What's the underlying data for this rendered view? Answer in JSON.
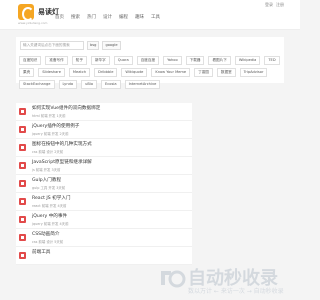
{
  "header": {
    "logo_text": "易读灯",
    "logo_sub": "www.yidudeng.com",
    "nav": [
      "首页",
      "搜索",
      "热门",
      "设计",
      "编程",
      "趣味",
      "工具"
    ],
    "top_links": [
      "登录",
      "注册"
    ]
  },
  "search": {
    "placeholder": "输入关键词后点击下面的搜索",
    "engines": [
      "bsg",
      "google"
    ]
  },
  "tags": [
    "百度知识",
    "准备写作",
    "知乎",
    "新华字",
    "Quora",
    "百度百度",
    "Yahoo",
    "下载器",
    "看图片下",
    "Wikipedia",
    "TED",
    "果壳",
    "Slideshare",
    "Meatch",
    "Dribbble",
    "Wikiquote",
    "Know Your Meme",
    "丁香园",
    "数据堂",
    "TripAdvisor",
    "StackExchange",
    "Lynda",
    "uBio",
    "Ecosia",
    "InternetArchive"
  ],
  "list": [
    {
      "title": "如何实现Vue组件的双向数据绑定",
      "meta": "html 前端 开发 1天前"
    },
    {
      "title": "jQuery插件的使用例子",
      "meta": "jquery 前端 开发 2天前"
    },
    {
      "title": "图标在按钮中的几种实现方式",
      "meta": "css 前端 设计 2天前"
    },
    {
      "title": "JavaScript原型链和继承详解",
      "meta": "js 前端 开发 3天前"
    },
    {
      "title": "Gulp入门教程",
      "meta": "gulp 工具 开发 3天前"
    },
    {
      "title": "React JS 初学入门",
      "meta": "react 前端 开发 4天前"
    },
    {
      "title": "jQuery 中的事件",
      "meta": "jquery 前端 开发 4天前"
    },
    {
      "title": "CSS动画简介",
      "meta": "css 前端 设计 5天前"
    },
    {
      "title": "前端工具",
      "meta": ""
    }
  ],
  "watermark": {
    "big": "自动秒收录",
    "small": "数以万计 ← 来访一次 → 自动秒收录"
  },
  "colors": {
    "accent": "#f5a623",
    "badge": "#e24a4a"
  }
}
